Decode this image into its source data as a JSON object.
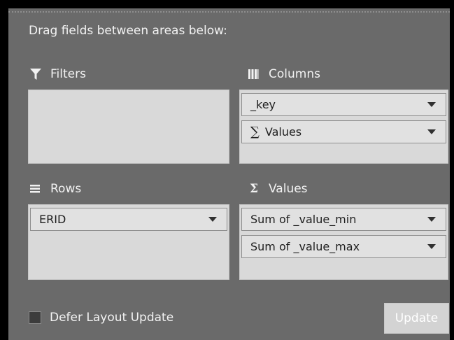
{
  "instructions": "Drag fields between areas below:",
  "areas": {
    "filters": {
      "label": "Filters",
      "icon": "filter-icon",
      "items": []
    },
    "columns": {
      "label": "Columns",
      "icon": "columns-icon",
      "items": [
        "_key",
        "Values"
      ]
    },
    "rows": {
      "label": "Rows",
      "icon": "rows-icon",
      "items": [
        "ERID"
      ]
    },
    "values": {
      "label": "Values",
      "icon": "sigma-icon",
      "items": [
        "Sum of _value_min",
        "Sum of _value_max"
      ]
    }
  },
  "footer": {
    "defer_label": "Defer Layout Update",
    "defer_checked": false,
    "update_label": "Update"
  },
  "colors": {
    "panel_bg": "#6a6a6a",
    "drop_area_bg": "#d9d9d9",
    "text_light": "#f2f2f2"
  }
}
